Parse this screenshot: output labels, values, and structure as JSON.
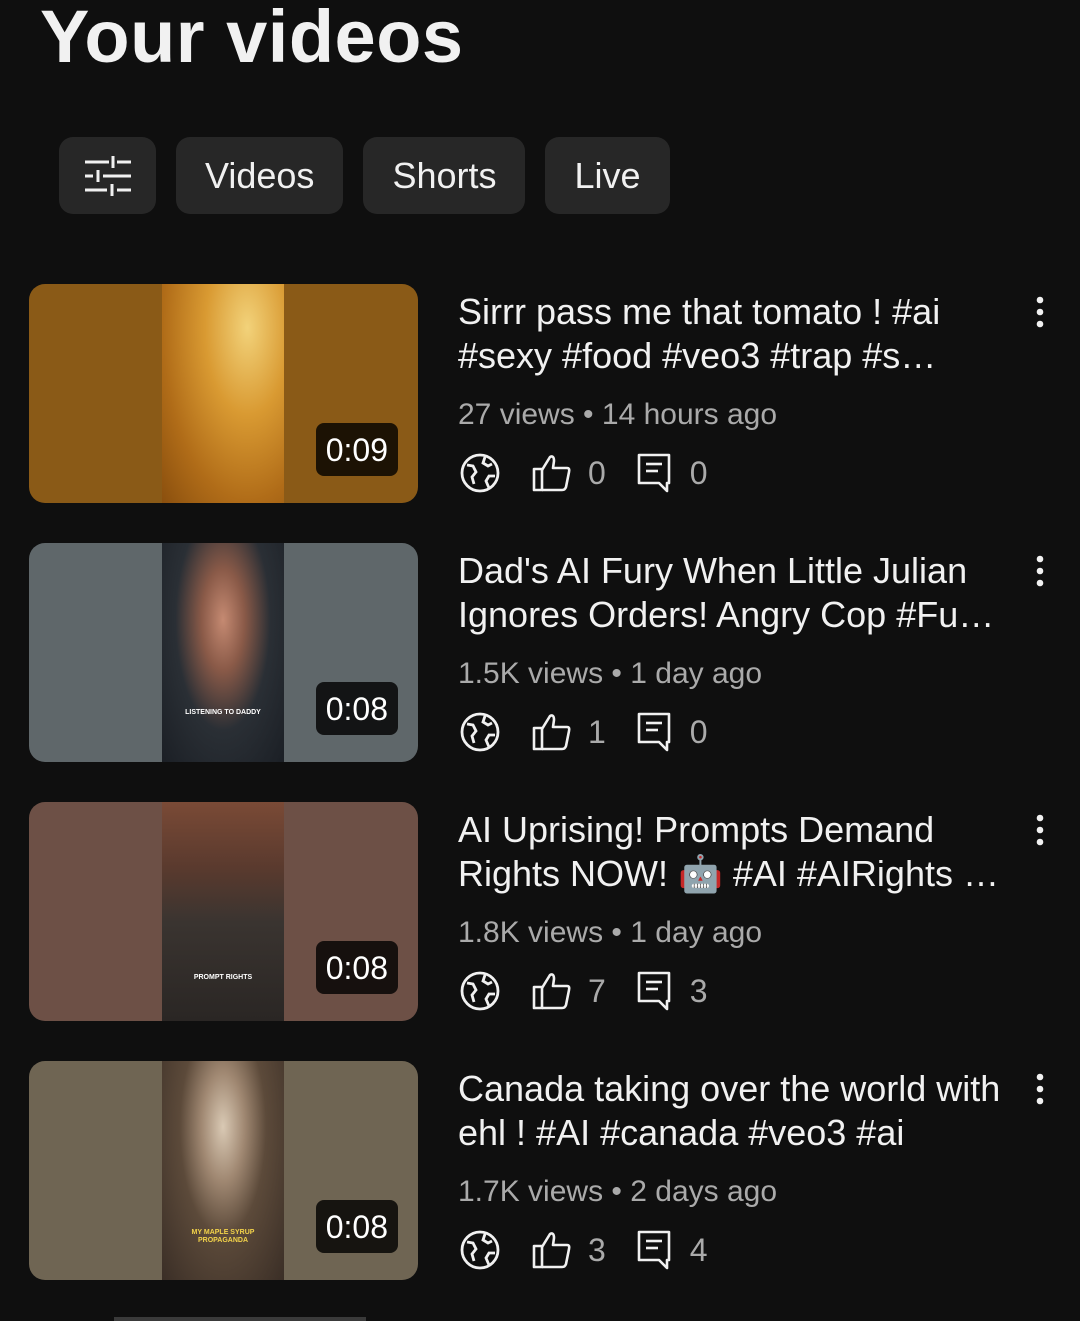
{
  "header": {
    "title": "Your videos"
  },
  "chips": [
    {
      "label": "Videos"
    },
    {
      "label": "Shorts"
    },
    {
      "label": "Live"
    }
  ],
  "videos": [
    {
      "title": "Sirrr pass me that tomato ! #ai #sexy #food #veo3 #trap #s…",
      "meta": "27 views • 14 hours ago",
      "duration": "0:09",
      "likes": "0",
      "comments": "0",
      "thumb_overlay": "",
      "colors": {
        "bg": "#8a5a17",
        "frame": "#b07421"
      }
    },
    {
      "title": "Dad's AI Fury  When Little Julian Ignores Orders! Angry Cop #Fu…",
      "meta": "1.5K views • 1 day ago",
      "duration": "0:08",
      "likes": "1",
      "comments": "0",
      "thumb_overlay": "LISTENING TO DADDY",
      "colors": {
        "bg": "#5f676a",
        "frame": "#2d3338"
      }
    },
    {
      "title": "AI Uprising! Prompts Demand Rights NOW! 🤖 #AI #AIRights …",
      "meta": "1.8K views • 1 day ago",
      "duration": "0:08",
      "likes": "7",
      "comments": "3",
      "thumb_overlay": "PROMPT RIGHTS",
      "colors": {
        "bg": "#6d5046",
        "frame": "#4a3a33"
      }
    },
    {
      "title": "Canada taking over the world with ehl ! #AI #canada  #veo3 #ai",
      "meta": "1.7K views • 2 days ago",
      "duration": "0:08",
      "likes": "3",
      "comments": "4",
      "thumb_overlay": "MY MAPLE SYRUP PROPAGANDA",
      "colors": {
        "bg": "#6f6553",
        "frame": "#3b3730"
      }
    }
  ]
}
